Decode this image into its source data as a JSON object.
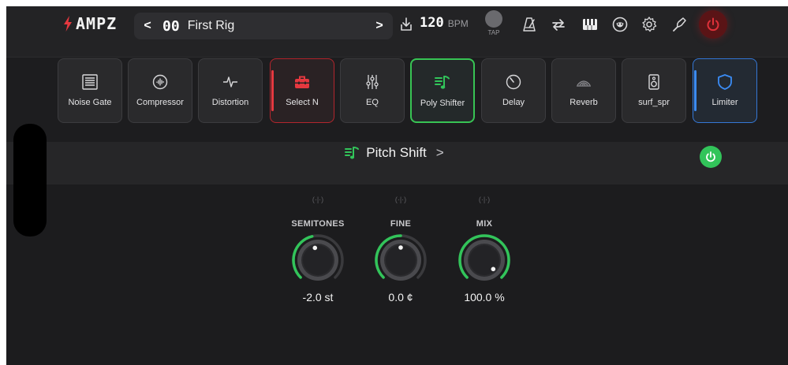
{
  "app": {
    "logo_text": "AMPZ"
  },
  "rig": {
    "prev_symbol": "<",
    "number": "00",
    "name": "First Rig",
    "next_symbol": ">"
  },
  "tempo": {
    "value": "120",
    "unit": "BPM",
    "tap_label": "TAP"
  },
  "header_icons": [
    "download-icon",
    "metronome-icon",
    "loop-icon",
    "piano-icon",
    "mask-icon",
    "gear-icon",
    "tuner-icon",
    "power-icon"
  ],
  "slots": [
    {
      "label": "Noise Gate",
      "icon": "noise-gate-icon",
      "state": "normal"
    },
    {
      "label": "Compressor",
      "icon": "compressor-icon",
      "state": "normal"
    },
    {
      "label": "Distortion",
      "icon": "distortion-icon",
      "state": "normal"
    },
    {
      "label": "Select N",
      "icon": "toolbox-icon",
      "state": "selected-red"
    },
    {
      "label": "EQ",
      "icon": "eq-icon",
      "state": "normal"
    },
    {
      "label": "Poly Shifter",
      "icon": "pitch-icon",
      "state": "active-green"
    },
    {
      "label": "Delay",
      "icon": "delay-icon",
      "state": "normal"
    },
    {
      "label": "Reverb",
      "icon": "reverb-icon",
      "state": "normal"
    },
    {
      "label": "surf_spr",
      "icon": "speaker-icon",
      "state": "normal"
    },
    {
      "label": "Limiter",
      "icon": "shield-icon",
      "state": "selected-blue"
    }
  ],
  "effect": {
    "title": "Pitch Shift",
    "chevron": ">",
    "enabled": true
  },
  "knobs": [
    {
      "label": "SEMITONES",
      "value": "-2.0 st",
      "level": 0.45
    },
    {
      "label": "FINE",
      "value": "0.0 ¢",
      "level": 0.5
    },
    {
      "label": "MIX",
      "value": "100.0 %",
      "level": 1.0
    }
  ],
  "colors": {
    "accent_green": "#32c45a",
    "select_red": "#e53840",
    "select_blue": "#3b8cf5",
    "power_red": "#e0313a"
  }
}
